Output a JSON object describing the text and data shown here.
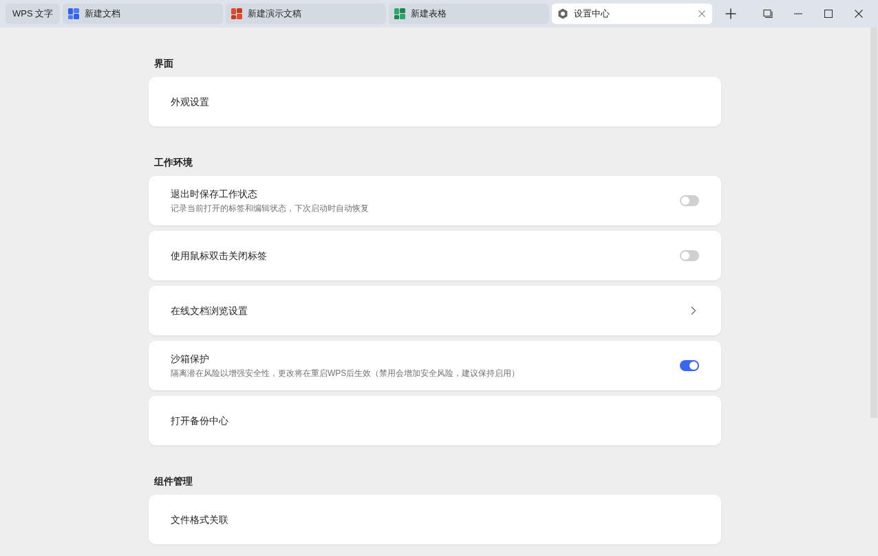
{
  "tabs": [
    {
      "kind": "home",
      "label": "WPS 文字",
      "selected": false
    },
    {
      "kind": "writer",
      "label": "新建文档",
      "selected": false
    },
    {
      "kind": "presentation",
      "label": "新建演示文稿",
      "selected": false
    },
    {
      "kind": "spreadsheet",
      "label": "新建表格",
      "selected": false
    },
    {
      "kind": "settings",
      "label": "设置中心",
      "selected": true
    }
  ],
  "sections": [
    {
      "title": "界面",
      "items": [
        {
          "kind": "plain",
          "title": "外观设置"
        }
      ]
    },
    {
      "title": "工作环境",
      "items": [
        {
          "kind": "toggle",
          "title": "退出时保存工作状态",
          "description": "记录当前打开的标签和编辑状态，下次启动时自动恢复",
          "on": false
        },
        {
          "kind": "toggle",
          "title": "使用鼠标双击关闭标签",
          "on": false
        },
        {
          "kind": "chevron",
          "title": "在线文档浏览设置"
        },
        {
          "kind": "toggle",
          "title": "沙箱保护",
          "description": "隔离潜在风险以增强安全性，更改将在重启WPS后生效（禁用会增加安全风险，建议保持启用）",
          "on": true
        },
        {
          "kind": "plain",
          "title": "打开备份中心"
        }
      ]
    },
    {
      "title": "组件管理",
      "items": [
        {
          "kind": "plain",
          "title": "文件格式关联"
        }
      ]
    }
  ]
}
